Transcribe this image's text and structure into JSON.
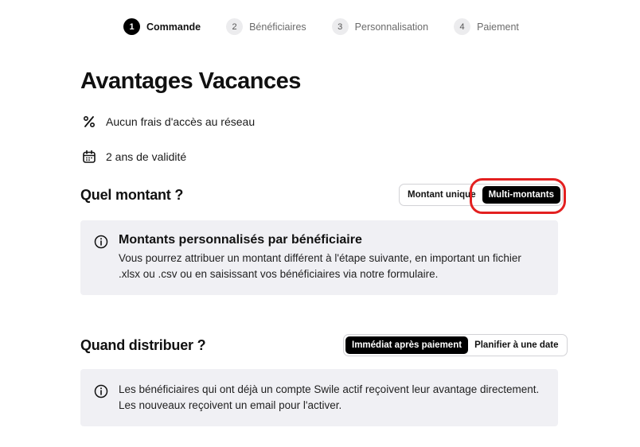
{
  "stepper": {
    "steps": [
      {
        "num": "1",
        "label": "Commande"
      },
      {
        "num": "2",
        "label": "Bénéficiaires"
      },
      {
        "num": "3",
        "label": "Personnalisation"
      },
      {
        "num": "4",
        "label": "Paiement"
      }
    ],
    "active_index": 0
  },
  "page": {
    "title": "Avantages Vacances"
  },
  "features": [
    {
      "icon": "percent-icon",
      "label": "Aucun frais d'accès au réseau"
    },
    {
      "icon": "calendar-icon",
      "label": "2 ans de validité"
    }
  ],
  "amount_section": {
    "title": "Quel montant ?",
    "options": [
      "Montant unique",
      "Multi-montants"
    ],
    "selected": "Multi-montants",
    "info": {
      "icon": "info-icon",
      "heading": "Montants personnalisés par bénéficiaire",
      "text": "Vous pourrez attribuer un montant différent à l'étape suivante, en important un fichier .xlsx ou .csv ou en saisissant vos bénéficiaires via notre formulaire."
    }
  },
  "distribution_section": {
    "title": "Quand distribuer ?",
    "options": [
      "Immédiat après paiement",
      "Planifier à une date"
    ],
    "selected": "Immédiat après paiement",
    "info": {
      "icon": "info-icon",
      "text": "Les bénéficiaires qui ont déjà un compte Swile actif reçoivent leur avantage directement. Les nouveaux reçoivent un email pour l'activer."
    }
  },
  "colors": {
    "accent": "#000000",
    "info_box_bg": "#f0f0f4",
    "highlight": "#e32020"
  }
}
